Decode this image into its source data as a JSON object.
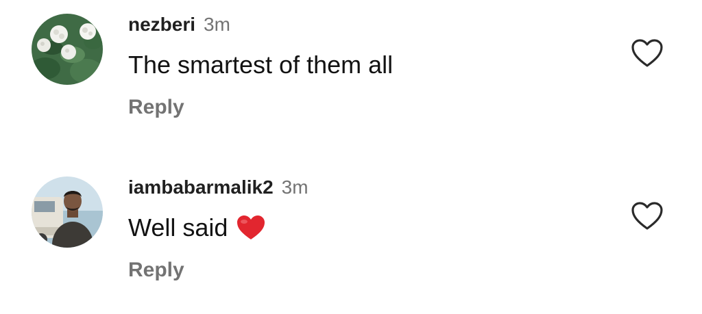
{
  "comments": [
    {
      "username": "nezberi",
      "time": "3m",
      "text": "The smartest of them all",
      "emoji": "",
      "reply_label": "Reply",
      "avatar_icon": "hydrangea-flowers-avatar"
    },
    {
      "username": "iambabarmalik2",
      "time": "3m",
      "text": "Well said",
      "emoji": "red-heart-emoji",
      "reply_label": "Reply",
      "avatar_icon": "man-by-car-avatar"
    }
  ],
  "colors": {
    "username": "#202020",
    "meta": "#737373",
    "text": "#121212",
    "heart_emoji": "#e2262f",
    "like_outline": "#2a2a2a"
  }
}
